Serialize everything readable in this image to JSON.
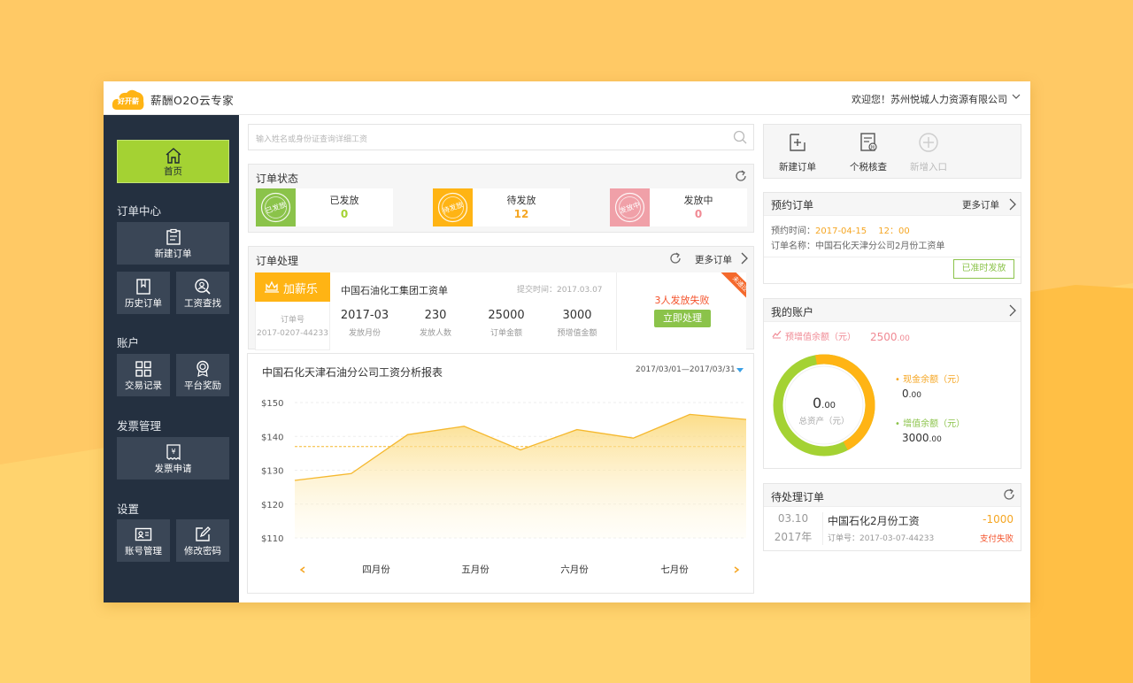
{
  "app": {
    "logo_text": "好开薪",
    "title": "薪酬O2O云专家",
    "welcome": "欢迎您！苏州悦城人力资源有限公司"
  },
  "sidebar": {
    "home": "首页",
    "groups": [
      {
        "title": "订单中心",
        "items": [
          "新建订单",
          "历史订单",
          "工资查找"
        ]
      },
      {
        "title": "账户",
        "items": [
          "交易记录",
          "平台奖励"
        ]
      },
      {
        "title": "发票管理",
        "items": [
          "发票申请"
        ]
      },
      {
        "title": "设置",
        "items": [
          "账号管理",
          "修改密码"
        ]
      }
    ]
  },
  "search": {
    "placeholder": "输入姓名或身份证查询详细工资"
  },
  "order_status": {
    "title": "订单状态",
    "cards": [
      {
        "label": "已发放",
        "value": "0",
        "stamp": "已发放",
        "color": "#8bc34a",
        "value_color": "#a4d233"
      },
      {
        "label": "待发放",
        "value": "12",
        "stamp": "待发放",
        "color": "#ffb414",
        "value_color": "#f5a623"
      },
      {
        "label": "发放中",
        "value": "0",
        "stamp": "发放中",
        "color": "#f0a0a8",
        "value_color": "#f08a94"
      }
    ]
  },
  "order_process": {
    "title": "订单处理",
    "more": "更多订单",
    "brand": "加薪乐",
    "order_no_label": "订单号",
    "order_no": "2017-0207-44233",
    "order_name": "中国石油化工集团工资单",
    "submit_time": "提交时间：2017.03.07",
    "metrics": [
      {
        "value": "2017-03",
        "label": "发放月份"
      },
      {
        "value": "230",
        "label": "发放人数"
      },
      {
        "value": "25000",
        "label": "订单金额"
      },
      {
        "value": "3000",
        "label": "预增值金额"
      }
    ],
    "fail_text": "3人发放失败",
    "action": "立即处理",
    "ribbon": "未通过"
  },
  "chart_panel": {
    "title": "中国石化天津石油分公司工资分析报表",
    "date_range": "2017/03/01—2017/03/31"
  },
  "chart_data": {
    "type": "area",
    "title": "中国石化天津石油分公司工资分析报表",
    "categories": [
      "四月份",
      "五月份",
      "六月份",
      "七月份"
    ],
    "x": [
      0,
      1,
      2,
      3,
      4,
      5,
      6,
      7,
      8
    ],
    "series": [
      {
        "values": [
          127,
          129,
          140.5,
          143,
          136,
          142,
          139.5,
          146.5,
          145
        ]
      }
    ],
    "ylim": [
      110,
      150
    ],
    "yticks": [
      "$150",
      "$140",
      "$130",
      "$120",
      "$110"
    ],
    "reference_line": 137,
    "color": "#f5b82e",
    "grid": true
  },
  "tools": [
    {
      "label": "新建订单",
      "enabled": true
    },
    {
      "label": "个税核查",
      "enabled": true
    },
    {
      "label": "新增入口",
      "enabled": false
    }
  ],
  "reservation": {
    "title": "预约订单",
    "more": "更多订单",
    "time_label": "预约时间：",
    "time_value": "2017-04-15　 12：00",
    "name_label": "订单名称：",
    "name_value": "中国石化天津分公司2月份工资单",
    "status": "已准时发放"
  },
  "account": {
    "title": "我的账户",
    "pre_label": "预增值余额（元）",
    "pre_value": "2500",
    "pre_decimal": ".00",
    "total_value": "0",
    "total_decimal": ".00",
    "total_label": "总资产（元）",
    "cash_label": "• 现金余额（元）",
    "cash_value": "0",
    "cash_decimal": ".00",
    "appr_label": "• 增值余额（元）",
    "appr_value": "3000",
    "appr_decimal": ".00",
    "ring_orange": 0.45,
    "ring_green": 0.55
  },
  "pending": {
    "title": "待处理订单",
    "date": "03.10",
    "year": "2017年",
    "name": "中国石化2月份工资",
    "order_no": "订单号：2017-03-07-44233",
    "amount": "-1000",
    "status": "支付失败"
  },
  "colors": {
    "accent_green": "#a4d233",
    "accent_orange": "#ffb414",
    "sidebar_bg": "#243040",
    "fail_red": "#f4532c"
  }
}
